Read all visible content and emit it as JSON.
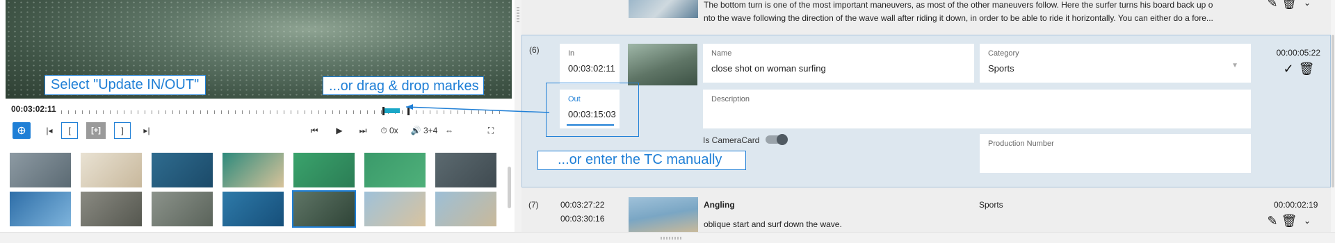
{
  "player": {
    "current_tc": "00:03:02:11",
    "annotations": {
      "update": "Select \"Update IN/OUT\"",
      "drag": "...or drag & drop markes",
      "manual": "...or enter the TC manually"
    },
    "controls": {
      "add_icon": "⊕",
      "go_in_icon": "|◂",
      "set_in_label": "[",
      "set_both_label": "[+]",
      "set_out_label": "]",
      "go_out_icon": "▸|",
      "prev_icon": "⏮",
      "play_icon": "▶",
      "next_icon": "⏭",
      "speed": "⏱ 0x",
      "audio": "🔊 3+4",
      "fit_icon": "⇔",
      "fullscreen_icon": "⛶"
    },
    "accent": "#1f7fd6"
  },
  "thumbnails": [
    {
      "colors": [
        "#8d9aa3",
        "#5b6a73"
      ]
    },
    {
      "colors": [
        "#e9e2d3",
        "#c8b89c"
      ]
    },
    {
      "colors": [
        "#2f6c8f",
        "#1b4a69"
      ]
    },
    {
      "colors": [
        "#2d8a7c",
        "#d8c39a"
      ]
    },
    {
      "colors": [
        "#3aa36c",
        "#2b7d55"
      ]
    },
    {
      "colors": [
        "#3a9a6a",
        "#4fb07a"
      ]
    },
    {
      "colors": [
        "#5c6a70",
        "#3f4a50"
      ]
    },
    {
      "colors": [
        "#2e6ea8",
        "#7eb4dc"
      ]
    },
    {
      "colors": [
        "#8a8a82",
        "#55574f"
      ]
    },
    {
      "colors": [
        "#8c938b",
        "#5a635a"
      ]
    },
    {
      "colors": [
        "#2e7aa9",
        "#164f7a"
      ]
    },
    {
      "colors": [
        "#5f7566",
        "#2f4437"
      ],
      "selected": true
    },
    {
      "colors": [
        "#9fc1d9",
        "#d8c39f"
      ]
    },
    {
      "colors": [
        "#9dbfd6",
        "#c9b99a"
      ]
    }
  ],
  "segments": [
    {
      "index": "",
      "description": [
        "The bottom turn is one of the most important maneuvers, as most of the other maneuvers follow. Here the surfer turns his board back up o",
        "nto the wave following the direction of the wave wall after riding it down, in order to be able to ride it horizontally. You can either do a fore..."
      ]
    },
    {
      "index": "(6)",
      "in_label": "In",
      "in_tc": "00:03:02:11",
      "out_label": "Out",
      "out_tc": "00:03:15:03",
      "name_label": "Name",
      "name_value": "close shot on woman surfing",
      "category_label": "Category",
      "category_value": "Sports",
      "description_label": "Description",
      "camera_card_label": "Is CameraCard",
      "production_label": "Production Number",
      "duration": "00:00:05:22",
      "confirm_icon": "✓",
      "delete_icon": "🗑"
    },
    {
      "index": "(7)",
      "in_tc": "00:03:27:22",
      "out_tc": "00:03:30:16",
      "name": "Angling",
      "category": "Sports",
      "description": "oblique start and surf down the wave.",
      "duration": "00:00:02:19",
      "edit_icon": "✎",
      "delete_icon": "🗑"
    }
  ]
}
